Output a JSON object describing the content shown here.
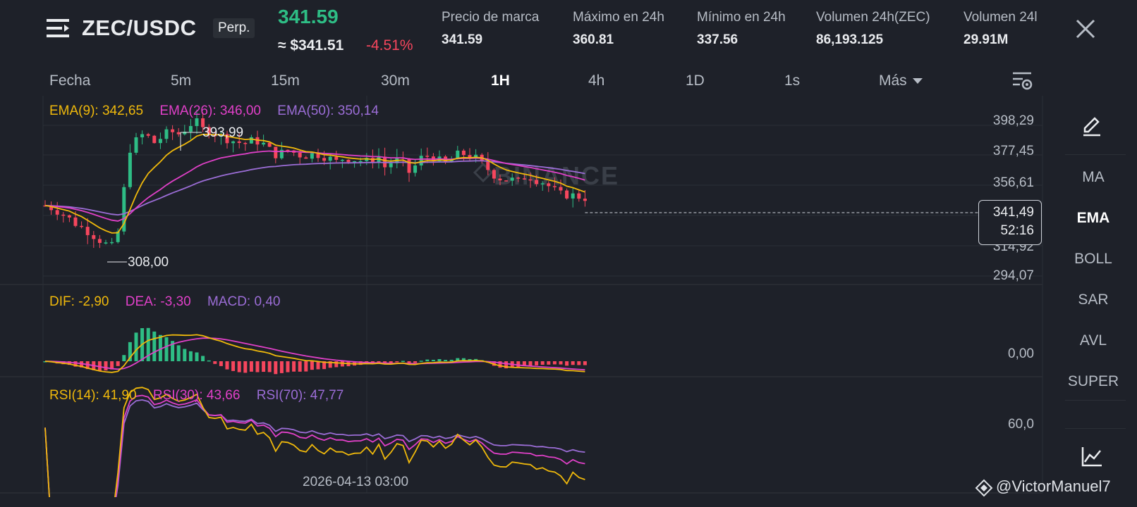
{
  "header": {
    "pair": "ZEC/USDC",
    "contract_badge": "Perp.",
    "last_price": "341.59",
    "usd_price": "≈ $341.51",
    "change_pct": "-4.51%",
    "stats": [
      {
        "label": "Precio de marca",
        "value": "341.59"
      },
      {
        "label": "Máximo en 24h",
        "value": "360.81"
      },
      {
        "label": "Mínimo en 24h",
        "value": "337.56"
      },
      {
        "label": "Volumen 24h(ZEC)",
        "value": "86,193.125"
      },
      {
        "label": "Volumen 24l",
        "value": "29.91M"
      }
    ],
    "menu_icon": "hamburger-icon",
    "close_icon": "close-icon"
  },
  "timeframes": {
    "items": [
      "Fecha",
      "5m",
      "15m",
      "30m",
      "1H",
      "4h",
      "1D",
      "1s",
      "Más"
    ],
    "active": "1H"
  },
  "indicators": {
    "items": [
      "MA",
      "EMA",
      "BOLL",
      "SAR",
      "AVL",
      "SUPER"
    ],
    "active": "EMA"
  },
  "colors": {
    "bg": "#1e2129",
    "up": "#2ebd85",
    "down": "#f6465d",
    "ema9": "#f0b90b",
    "ema26": "#e040c8",
    "ema50": "#9b6dd6"
  },
  "legends": {
    "ema": [
      {
        "text": "EMA(9): 342,65",
        "color": "#f0b90b"
      },
      {
        "text": "EMA(26): 346,00",
        "color": "#e040c8"
      },
      {
        "text": "EMA(50): 350,14",
        "color": "#9b6dd6"
      }
    ],
    "macd": [
      {
        "text": "DIF: -2,90",
        "color": "#f0b90b"
      },
      {
        "text": "DEA: -3,30",
        "color": "#e040c8"
      },
      {
        "text": "MACD: 0,40",
        "color": "#9b6dd6"
      }
    ],
    "rsi": [
      {
        "text": "RSI(14): 41,90",
        "color": "#f0b90b"
      },
      {
        "text": "RSI(30): 43,66",
        "color": "#e040c8"
      },
      {
        "text": "RSI(70): 47,77",
        "color": "#9b6dd6"
      }
    ]
  },
  "axis": {
    "price_ticks": [
      "398,29",
      "377,45",
      "356,61",
      "314,92",
      "294,07"
    ],
    "macd_tick": "0,00",
    "rsi_tick": "60,0",
    "date_label": "2026-04-13 03:00"
  },
  "annotations": {
    "high": "393,99",
    "low": "308,00"
  },
  "current_price": {
    "price": "341,49",
    "countdown": "52:16"
  },
  "watermark": {
    "exchange": "BINANCE",
    "user": "@VictorManuel7"
  },
  "chart_data": {
    "type": "candlestick",
    "price_ylim": [
      285,
      405
    ],
    "candles_close_path": [
      336,
      334,
      331,
      327,
      323,
      320,
      316,
      312,
      309,
      322,
      371,
      378,
      383,
      376,
      380,
      384,
      382,
      386,
      391,
      385,
      384,
      381,
      379,
      377,
      376,
      378,
      377,
      372,
      368,
      372,
      370,
      368,
      369,
      369,
      367,
      364,
      367,
      366,
      365,
      364,
      369,
      360,
      366,
      364,
      356,
      366,
      368,
      367,
      362,
      366,
      370,
      368,
      366,
      361,
      356,
      353,
      353,
      351,
      356,
      353,
      351,
      347,
      343,
      343,
      342,
      341
    ],
    "ema": [
      {
        "name": "EMA(9)",
        "last": 342.65
      },
      {
        "name": "EMA(26)",
        "last": 346.0
      },
      {
        "name": "EMA(50)",
        "last": 350.14
      }
    ]
  }
}
